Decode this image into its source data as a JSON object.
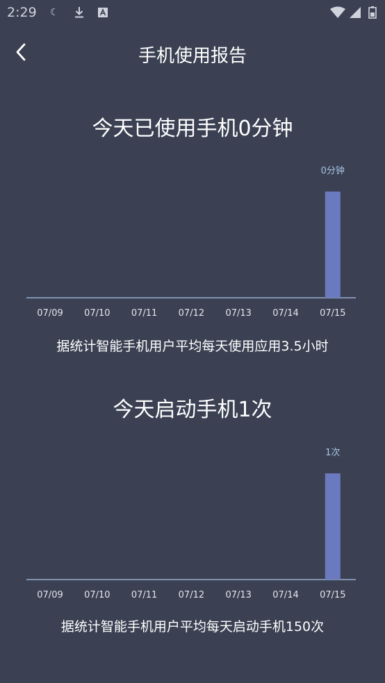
{
  "status_bar": {
    "time": "2:29",
    "icons": [
      "moon-icon",
      "download-icon",
      "a-box-icon",
      "wifi-icon",
      "cell-signal-icon",
      "battery-icon"
    ]
  },
  "header": {
    "title": "手机使用报告",
    "back_icon": "chevron-left-icon"
  },
  "usage_section": {
    "title": "今天已使用手机0分钟",
    "caption": "据统计智能手机用户平均每天使用应用3.5小时"
  },
  "launch_section": {
    "title": "今天启动手机1次",
    "caption": "据统计智能手机用户平均每天启动手机150次"
  },
  "colors": {
    "background": "#3b4153",
    "bar": "#6b7abf",
    "axis": "#a9c4e6",
    "value_label": "#a9c4e6",
    "tick_label": "#e4e6ec"
  },
  "chart_data": [
    {
      "type": "bar",
      "categories": [
        "07/09",
        "07/10",
        "07/11",
        "07/12",
        "07/13",
        "07/14",
        "07/15"
      ],
      "values": [
        0,
        0,
        0,
        0,
        0,
        0,
        0
      ],
      "data_labels": [
        "",
        "",
        "",
        "",
        "",
        "",
        "0分钟"
      ],
      "highlight_index": 6,
      "title": "",
      "xlabel": "",
      "ylabel": "",
      "grid": false,
      "y_axis_visible": false
    },
    {
      "type": "bar",
      "categories": [
        "07/09",
        "07/10",
        "07/11",
        "07/12",
        "07/13",
        "07/14",
        "07/15"
      ],
      "values": [
        0,
        0,
        0,
        0,
        0,
        0,
        1
      ],
      "data_labels": [
        "",
        "",
        "",
        "",
        "",
        "",
        "1次"
      ],
      "highlight_index": 6,
      "title": "",
      "xlabel": "",
      "ylabel": "",
      "grid": false,
      "y_axis_visible": false
    }
  ]
}
